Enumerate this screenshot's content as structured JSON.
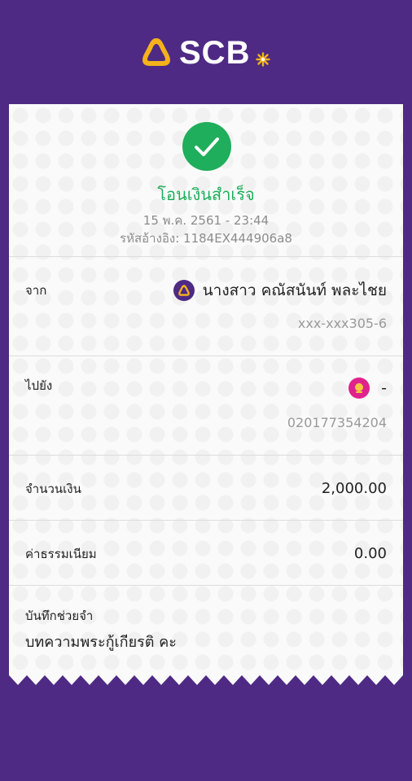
{
  "header": {
    "logo_text": "SCB",
    "logo_icon": "scb-shell-icon",
    "brand_color": "#4e2a84",
    "logo_accent": "#f5b21a"
  },
  "status": {
    "icon": "check-circle-icon",
    "title": "โอนเงินสำเร็จ",
    "datetime": "15 พ.ค. 2561 - 23:44",
    "reference": "รหัสอ้างอิง: 1184EX444906a8",
    "success_color": "#1fae5b"
  },
  "from": {
    "label": "จาก",
    "name": "นางสาว คณัสนันท์ พละไชย",
    "account": "xxx-xxx305-6",
    "bank_icon": "scb-bank-icon"
  },
  "to": {
    "label": "ไปยัง",
    "name": "-",
    "account": "020177354204",
    "bank_icon": "gsb-bank-icon"
  },
  "amount": {
    "label": "จำนวนเงิน",
    "value": "2,000.00"
  },
  "fee": {
    "label": "ค่าธรรมเนียม",
    "value": "0.00"
  },
  "memo": {
    "label": "บันทึกช่วยจำ",
    "value": "บทความพระกู้เกียรติ คะ"
  }
}
